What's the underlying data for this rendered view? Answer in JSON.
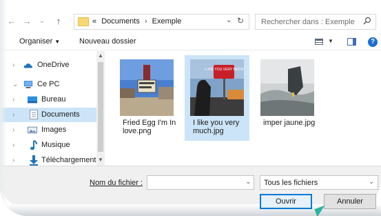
{
  "address_bar": {
    "back_glyph": "←",
    "forward_glyph": "→",
    "recent_glyph": "⌄",
    "up_glyph": "↑",
    "overflow": "«",
    "crumbs": [
      "Documents",
      "Exemple"
    ],
    "search_placeholder": "Rechercher dans : Exemple"
  },
  "toolbar": {
    "organize_label": "Organiser",
    "new_folder_label": "Nouveau dossier"
  },
  "nav_pane": {
    "items": [
      {
        "label": "OneDrive",
        "icon": "cloud-icon",
        "chevron": "›",
        "color": "#1e73be"
      },
      {
        "label": "Ce PC",
        "icon": "computer-icon",
        "chevron": "⌄",
        "color": "#2b7bd6"
      },
      {
        "label": "Bureau",
        "icon": "desktop-icon",
        "chevron": "›",
        "color": "#2b8fe0"
      },
      {
        "label": "Documents",
        "icon": "document-icon",
        "chevron": "›",
        "color": "#8a9aad"
      },
      {
        "label": "Images",
        "icon": "pictures-icon",
        "chevron": "›",
        "color": "#5a7fa8"
      },
      {
        "label": "Musique",
        "icon": "music-icon",
        "chevron": "›",
        "color": "#1e73be"
      },
      {
        "label": "Téléchargement",
        "icon": "download-icon",
        "chevron": "›",
        "color": "#1e73be"
      }
    ],
    "selected": "Documents"
  },
  "files": [
    {
      "name_line1": "Fried Egg I'm In",
      "name_line2": "love.png"
    },
    {
      "name_line1": "I like you very",
      "name_line2": "much.jpg",
      "sign_text": "I LIKE YOU VERY MUCH"
    },
    {
      "name_line1": "imper jaune.jpg",
      "name_line2": ""
    }
  ],
  "bottom": {
    "filename_label": "Nom du fichier :",
    "filename_value": "",
    "filetype_value": "Tous les fichiers",
    "open_label": "Ouvrir",
    "cancel_label": "Annuler"
  },
  "colors": {
    "accent": "#0078d7",
    "selection": "#cce4f7",
    "cursor": "#2ab5a0"
  }
}
